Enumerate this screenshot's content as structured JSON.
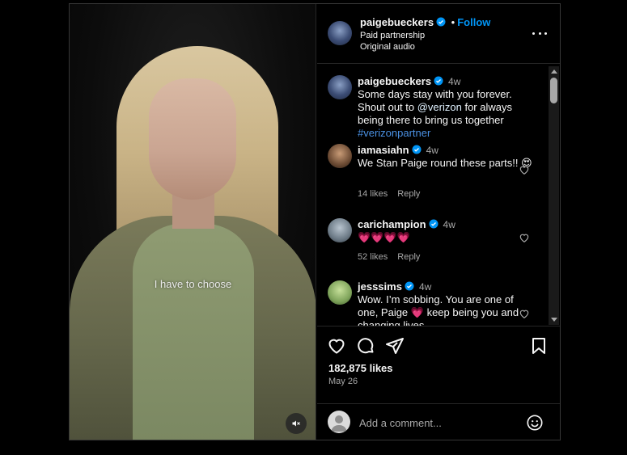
{
  "video": {
    "caption": "I have to choose",
    "muted_icon": "speaker-muted-icon"
  },
  "header": {
    "username": "paigebueckers",
    "separator": "•",
    "follow_label": "Follow",
    "subtitle1": "Paid partnership",
    "subtitle2": "Original audio",
    "more_icon": "more-options-icon"
  },
  "caption_comment": {
    "username": "paigebueckers",
    "time": "4w",
    "text_part1": "Some days stay with you forever. Shout out to ",
    "mention": "@verizon",
    "text_part2": " for always being there to bring us together ",
    "hashtag": "#verizonpartner"
  },
  "comments": [
    {
      "username": "iamasiahn",
      "time": "4w",
      "text": "We Stan Paige round these parts!! 😍",
      "likes": "14 likes",
      "reply": "Reply"
    },
    {
      "username": "carichampion",
      "time": "4w",
      "text": "💗💗💗💗",
      "likes": "52 likes",
      "reply": "Reply"
    },
    {
      "username": "jesssims",
      "time": "4w",
      "text": "Wow. I’m sobbing. You are one of one, Paige 💗 keep being you and changing lives"
    }
  ],
  "actions": {
    "likes": "182,875 likes",
    "date": "May 26"
  },
  "add_comment": {
    "placeholder": "Add a comment..."
  },
  "colors": {
    "background": "#000000",
    "accent": "#0095f6",
    "hashtag": "#4a90e2",
    "muted_text": "#a8a8a8",
    "border": "#262626"
  }
}
